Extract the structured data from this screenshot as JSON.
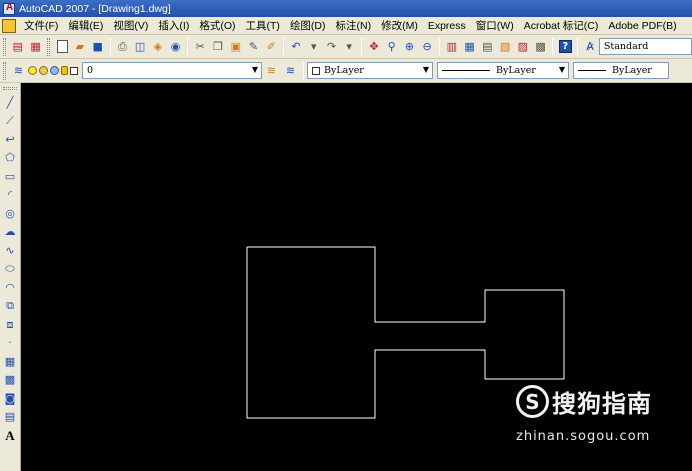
{
  "window": {
    "title": "AutoCAD 2007 - [Drawing1.dwg]"
  },
  "menu": {
    "items": [
      "文件(F)",
      "编辑(E)",
      "视图(V)",
      "插入(I)",
      "格式(O)",
      "工具(T)",
      "绘图(D)",
      "标注(N)",
      "修改(M)",
      "Express",
      "窗口(W)",
      "Acrobat 标记(C)",
      "Adobe PDF(B)"
    ]
  },
  "toolbar": {
    "text_style": "Standard",
    "help_label": "?"
  },
  "properties": {
    "layer": "0",
    "color": "ByLayer",
    "linetype": "ByLayer",
    "lineweight": "ByLayer"
  },
  "draw_tools": {
    "text_tool_label": "A"
  },
  "watermark": {
    "logo_letter": "S",
    "brand": "搜狗指南",
    "url": "zhinan.sogou.com"
  },
  "colors": {
    "canvas": "#000000",
    "drawing_line": "#ffffff",
    "titlebar": "#2a5bb5",
    "chrome": "#ece9d8"
  }
}
